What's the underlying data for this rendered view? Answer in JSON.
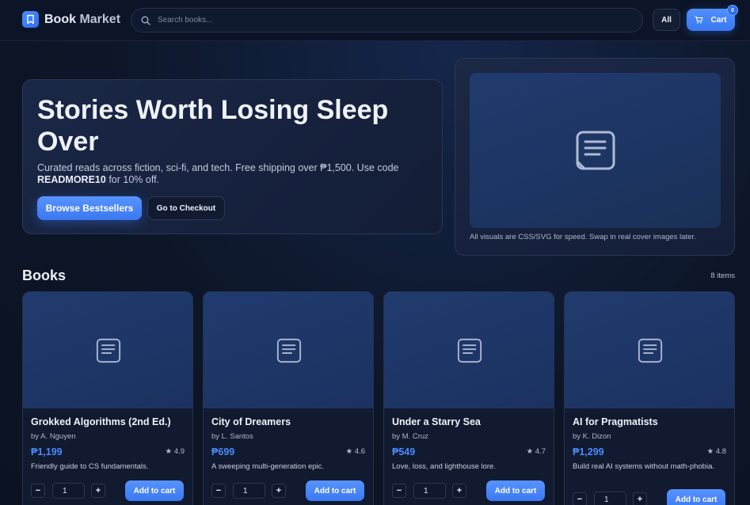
{
  "header": {
    "logo_text_main": "Book",
    "logo_text_accent": "Market",
    "logo_icon": "bookmark-icon",
    "search_placeholder": "Search books...",
    "filter_label": "All",
    "cart_label": "Cart",
    "cart_count": "0",
    "accent_color": "#3b78f1"
  },
  "hero": {
    "title": "Stories Worth Losing Sleep Over",
    "subtitle_before": "Curated reads across fiction, sci-fi, and tech. Free shipping over ₱1,500. Use code",
    "promo_code": "READMORE10",
    "subtitle_after": "for 10% off.",
    "primary_button": "Browse Bestsellers",
    "secondary_button": "Go to Checkout"
  },
  "visual": {
    "caption": "All visuals are CSS/SVG for speed. Swap in real cover images later.",
    "icon": "document-icon"
  },
  "section": {
    "title": "Books",
    "count": "8 items"
  },
  "books": [
    {
      "title": "Grokked Algorithms (2nd Ed.)",
      "author": "by A. Nguyen",
      "price": "₱1,199",
      "rating": "★ 4.9",
      "description": "Friendly guide to CS fundamentals.",
      "qty": "1",
      "add_label": "Add to cart",
      "minus": "−",
      "plus": "+"
    },
    {
      "title": "City of Dreamers",
      "author": "by L. Santos",
      "price": "₱699",
      "rating": "★ 4.6",
      "description": "A sweeping multi-generation epic.",
      "qty": "1",
      "add_label": "Add to cart",
      "minus": "−",
      "plus": "+"
    },
    {
      "title": "Under a Starry Sea",
      "author": "by M. Cruz",
      "price": "₱549",
      "rating": "★ 4.7",
      "description": "Love, loss, and lighthouse lore.",
      "qty": "1",
      "add_label": "Add to cart",
      "minus": "−",
      "plus": "+"
    },
    {
      "title": "AI for Pragmatists",
      "author": "by K. Dizon",
      "price": "₱1,299",
      "rating": "★ 4.8",
      "description": "Build real AI systems without math-phobia.",
      "qty": "1",
      "add_label": "Add to cart",
      "minus": "−",
      "plus": "+"
    }
  ]
}
